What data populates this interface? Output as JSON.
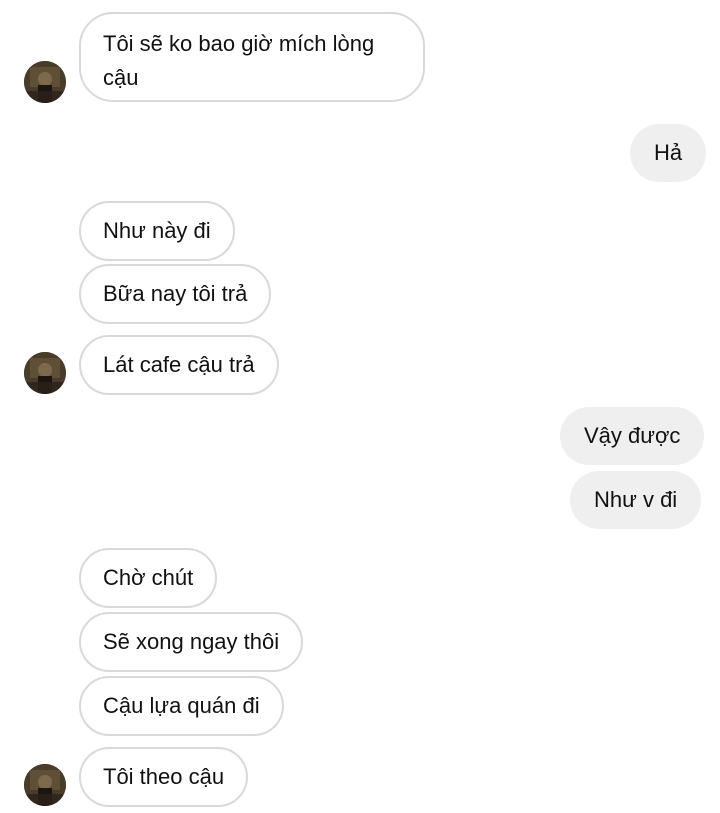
{
  "messages": [
    {
      "id": 1,
      "side": "in",
      "text": "Tôi sẽ ko bao giờ mích lòng cậu"
    },
    {
      "id": 2,
      "side": "out",
      "text": "Hả"
    },
    {
      "id": 3,
      "side": "in",
      "text": "Như này đi"
    },
    {
      "id": 4,
      "side": "in",
      "text": "Bữa nay tôi trả"
    },
    {
      "id": 5,
      "side": "in",
      "text": "Lát cafe cậu trả"
    },
    {
      "id": 6,
      "side": "out",
      "text": "Vậy được"
    },
    {
      "id": 7,
      "side": "out",
      "text": "Như v đi"
    },
    {
      "id": 8,
      "side": "in",
      "text": "Chờ chút"
    },
    {
      "id": 9,
      "side": "in",
      "text": "Sẽ xong ngay thôi"
    },
    {
      "id": 10,
      "side": "in",
      "text": "Cậu lựa quán đi"
    },
    {
      "id": 11,
      "side": "in",
      "text": "Tôi theo cậu"
    }
  ],
  "colors": {
    "incoming_bubble_bg": "#ffffff",
    "incoming_bubble_border": "#d9d9d9",
    "outgoing_bubble_bg": "#efefef",
    "text": "#111111"
  },
  "icons": {
    "avatar": "contact-avatar-photo"
  }
}
